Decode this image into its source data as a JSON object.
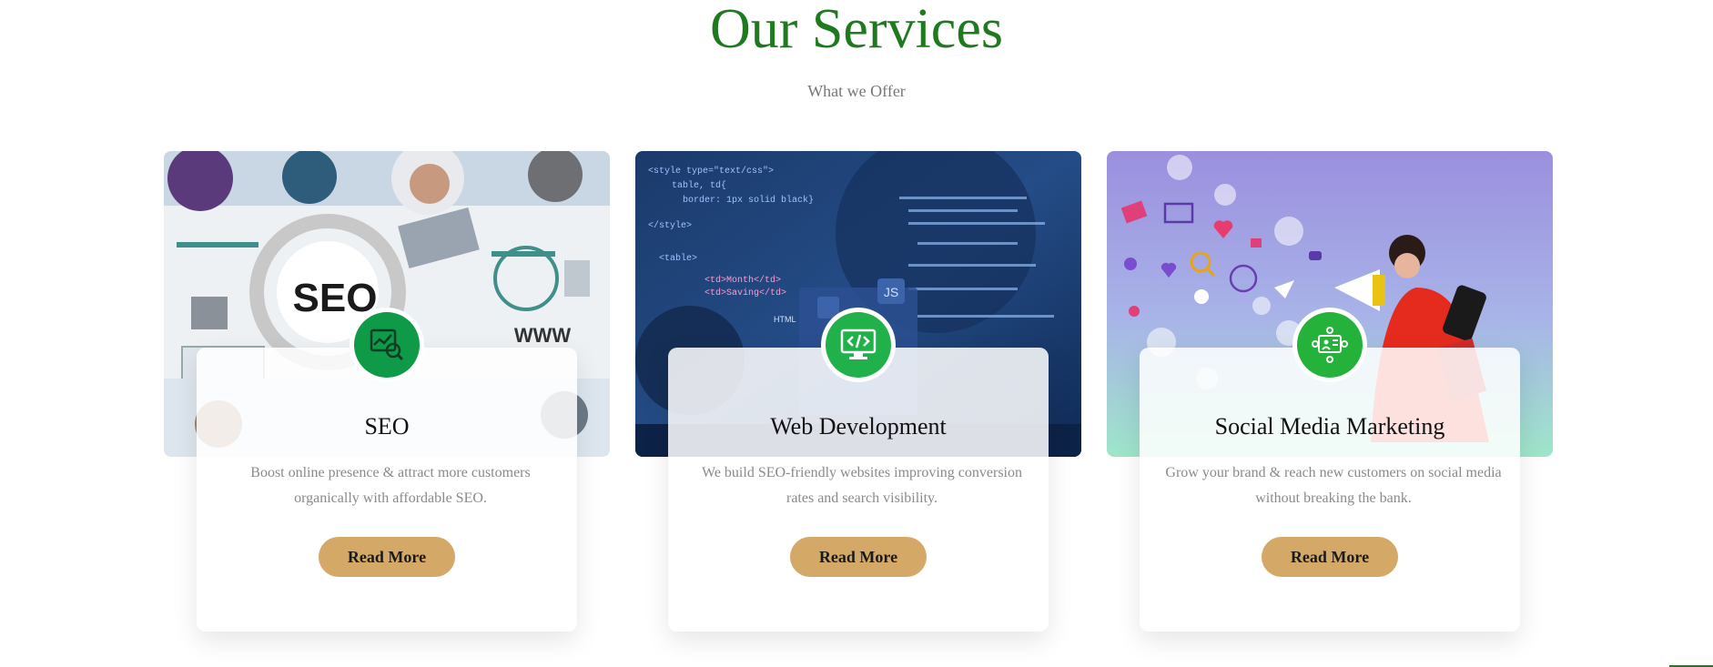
{
  "section": {
    "title": "Our Services",
    "subtitle": "What we Offer"
  },
  "colors": {
    "title_green": "#1f7a1f",
    "badge_green": "#1da34a",
    "button_gold": "#d4a866"
  },
  "cards": [
    {
      "title": "SEO",
      "description": "Boost online presence & attract more customers organically with affordable SEO.",
      "button_label": "Read More",
      "icon": "seo-chart-magnifier-icon",
      "image_text": [
        "SEO",
        "WWW"
      ]
    },
    {
      "title": "Web Development",
      "description": "We build SEO-friendly websites improving conversion rates and search visibility.",
      "button_label": "Read More",
      "icon": "code-monitor-icon",
      "image_text": [
        "<style type=\"text/css\">",
        "table, td{",
        "border: 1px solid black}",
        "</style>",
        "<table>",
        "<td>Month</td>",
        "<td>Saving</td>",
        "JS",
        "HTML"
      ]
    },
    {
      "title": "Social Media Marketing",
      "description": "Grow your brand & reach new customers on social media without breaking the bank.",
      "button_label": "Read More",
      "icon": "social-network-icon",
      "image_text": []
    }
  ]
}
